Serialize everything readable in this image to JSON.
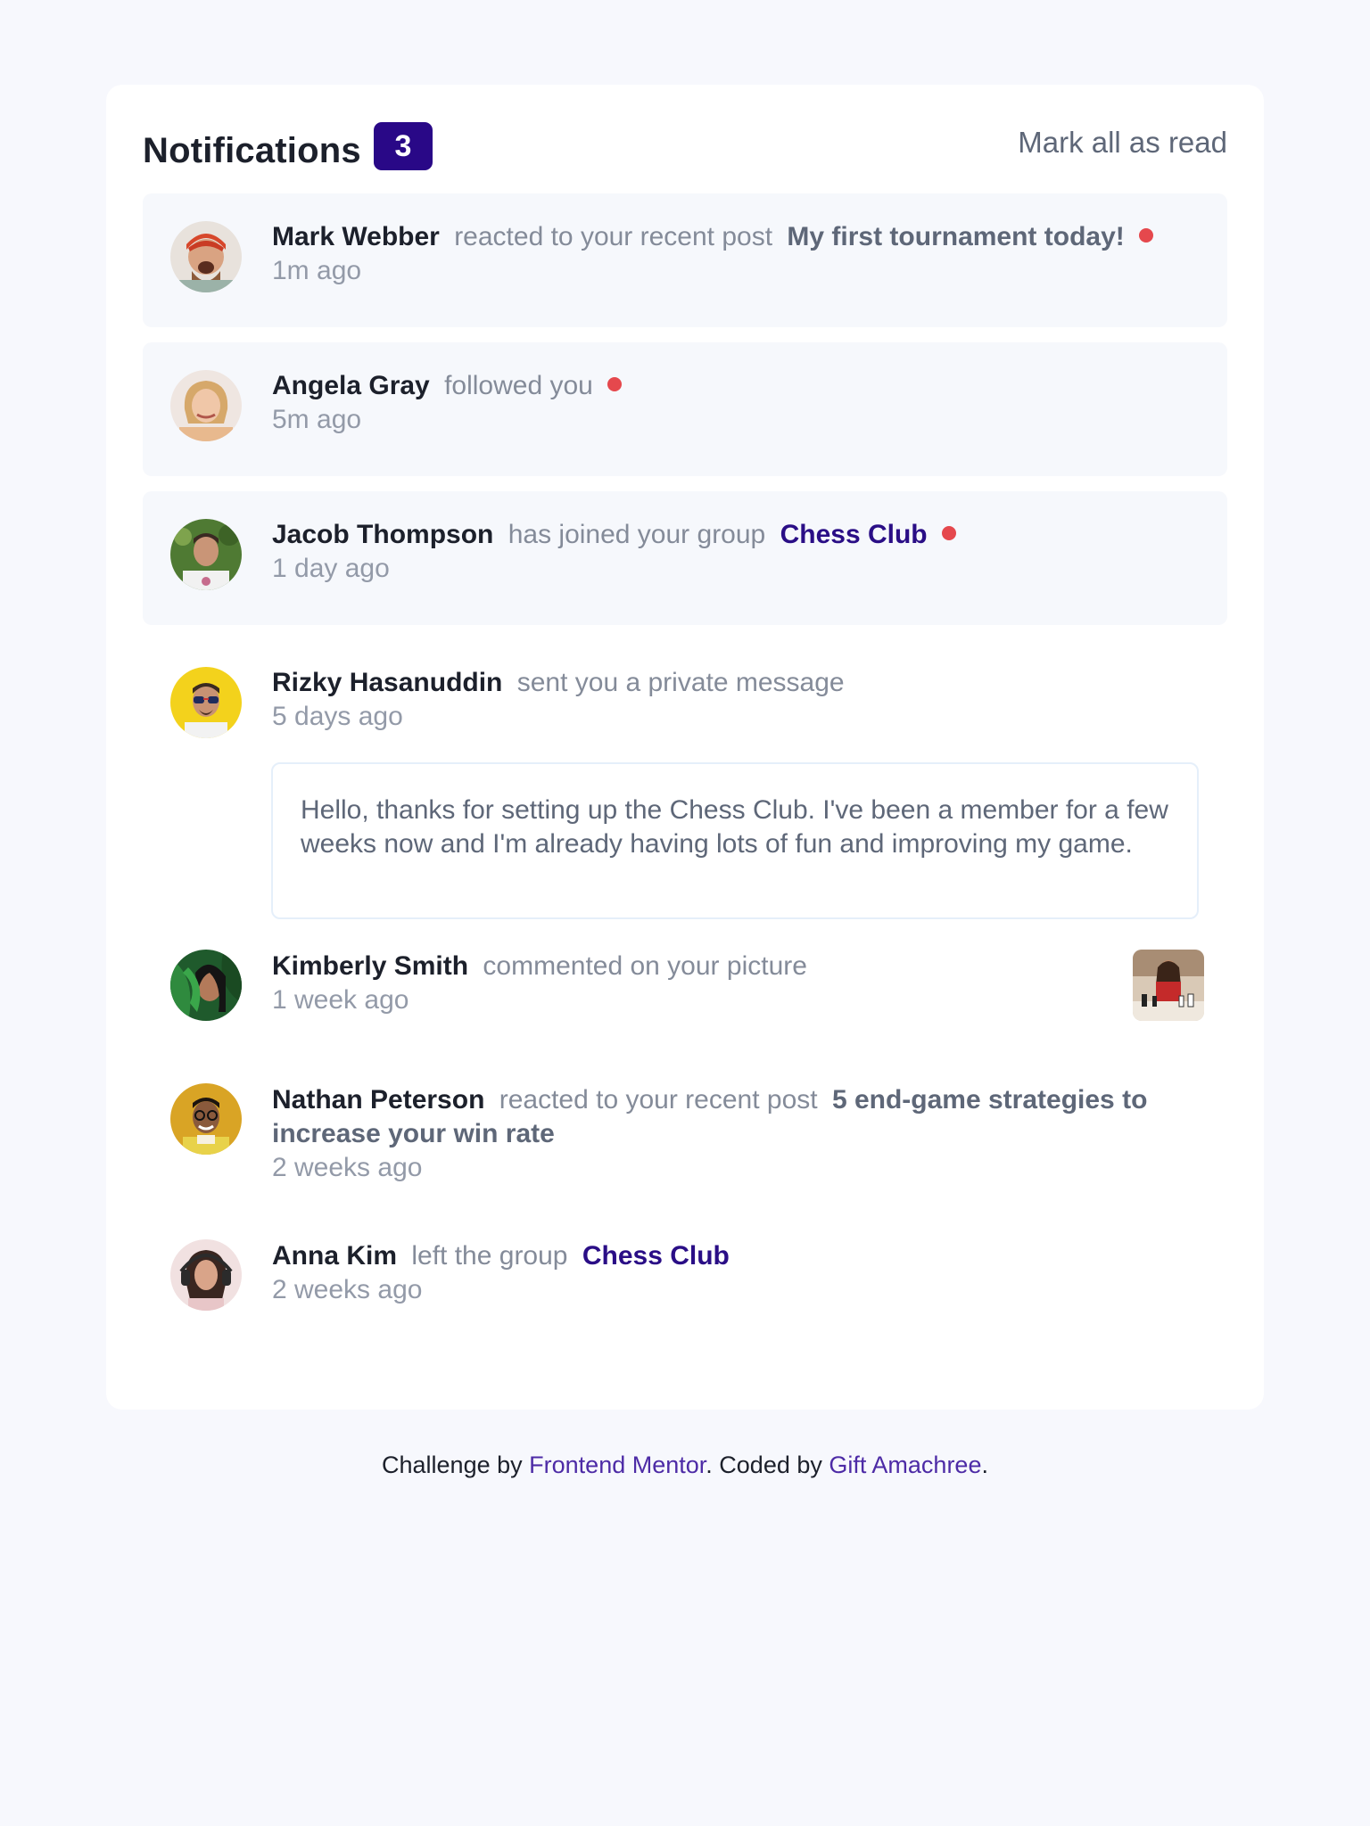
{
  "header": {
    "title": "Notifications",
    "badge_count": "3",
    "mark_all_label": "Mark all as read"
  },
  "notifications": [
    {
      "name": "Mark Webber",
      "action": "reacted to your recent post",
      "post": "My first tournament today!",
      "time": "1m ago",
      "unread": true
    },
    {
      "name": "Angela Gray",
      "action": "followed you",
      "time": "5m ago",
      "unread": true
    },
    {
      "name": "Jacob Thompson",
      "action": "has joined your group",
      "group": "Chess Club",
      "time": "1 day ago",
      "unread": true
    },
    {
      "name": "Rizky Hasanuddin",
      "action": "sent you a private message",
      "time": "5 days ago",
      "message": "Hello, thanks for setting up the Chess Club. I've been a member for a few weeks now and I'm already having lots of fun and improving my game.",
      "unread": false
    },
    {
      "name": "Kimberly Smith",
      "action": "commented on your picture",
      "time": "1 week ago",
      "unread": false
    },
    {
      "name": "Nathan Peterson",
      "action": "reacted to your recent post",
      "post": "5 end-game strategies to increase your win rate",
      "time": "2 weeks ago",
      "unread": false
    },
    {
      "name": "Anna Kim",
      "action": "left the group",
      "group": "Chess Club",
      "time": "2 weeks ago",
      "unread": false
    }
  ],
  "footer": {
    "prefix": "Challenge by",
    "link1": "Frontend Mentor",
    "middle": ". Coded by",
    "link2": "Gift Amachree",
    "suffix": "."
  },
  "colors": {
    "unread_dot": "#e5484d",
    "badge_bg": "#290887",
    "page_bg": "#f7f8fd"
  }
}
